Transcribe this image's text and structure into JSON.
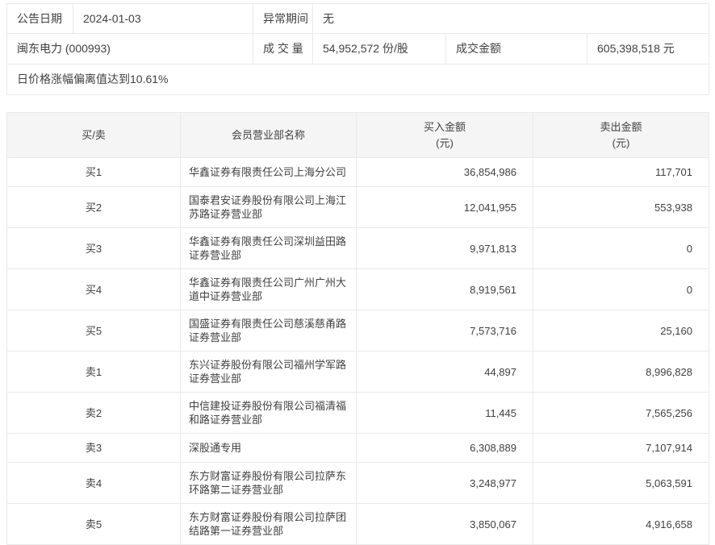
{
  "colors": {
    "page_bg": "#ffffff",
    "header_bg": "#f5f5f5",
    "border": "#e9e9e9",
    "text": "#404040"
  },
  "info": {
    "announce_date_label": "公告日期",
    "announce_date_value": "2024-01-03",
    "abnormal_period_label": "异常期间",
    "abnormal_period_value": "无",
    "stock_name": "闽东电力 (000993)",
    "volume_label": "成 交 量",
    "volume_value": "54,952,572 份/股",
    "turnover_label": "成交金额",
    "turnover_value": "605,398,518 元",
    "deviation_note": "日价格涨幅偏离值达到10.61%"
  },
  "broker_table": {
    "headers": {
      "side": "买/卖",
      "branch": "会员营业部名称",
      "buy_line1": "买入金额",
      "buy_line2": "(元)",
      "sell_line1": "卖出金额",
      "sell_line2": "(元)"
    },
    "rows": [
      {
        "side": "买1",
        "branch": "华鑫证券有限责任公司上海分公司",
        "buy": "36,854,986",
        "sell": "117,701"
      },
      {
        "side": "买2",
        "branch": "国泰君安证券股份有限公司上海江苏路证券营业部",
        "buy": "12,041,955",
        "sell": "553,938"
      },
      {
        "side": "买3",
        "branch": "华鑫证券有限责任公司深圳益田路证券营业部",
        "buy": "9,971,813",
        "sell": "0"
      },
      {
        "side": "买4",
        "branch": "华鑫证券有限责任公司广州广州大道中证券营业部",
        "buy": "8,919,561",
        "sell": "0"
      },
      {
        "side": "买5",
        "branch": "国盛证券有限责任公司慈溪慈甬路证券营业部",
        "buy": "7,573,716",
        "sell": "25,160"
      },
      {
        "side": "卖1",
        "branch": "东兴证券股份有限公司福州学军路证券营业部",
        "buy": "44,897",
        "sell": "8,996,828"
      },
      {
        "side": "卖2",
        "branch": "中信建投证券股份有限公司福清福和路证券营业部",
        "buy": "11,445",
        "sell": "7,565,256"
      },
      {
        "side": "卖3",
        "branch": "深股通专用",
        "buy": "6,308,889",
        "sell": "7,107,914"
      },
      {
        "side": "卖4",
        "branch": "东方财富证券股份有限公司拉萨东环路第二证券营业部",
        "buy": "3,248,977",
        "sell": "5,063,591"
      },
      {
        "side": "卖5",
        "branch": "东方财富证券股份有限公司拉萨团结路第一证券营业部",
        "buy": "3,850,067",
        "sell": "4,916,658"
      }
    ]
  }
}
